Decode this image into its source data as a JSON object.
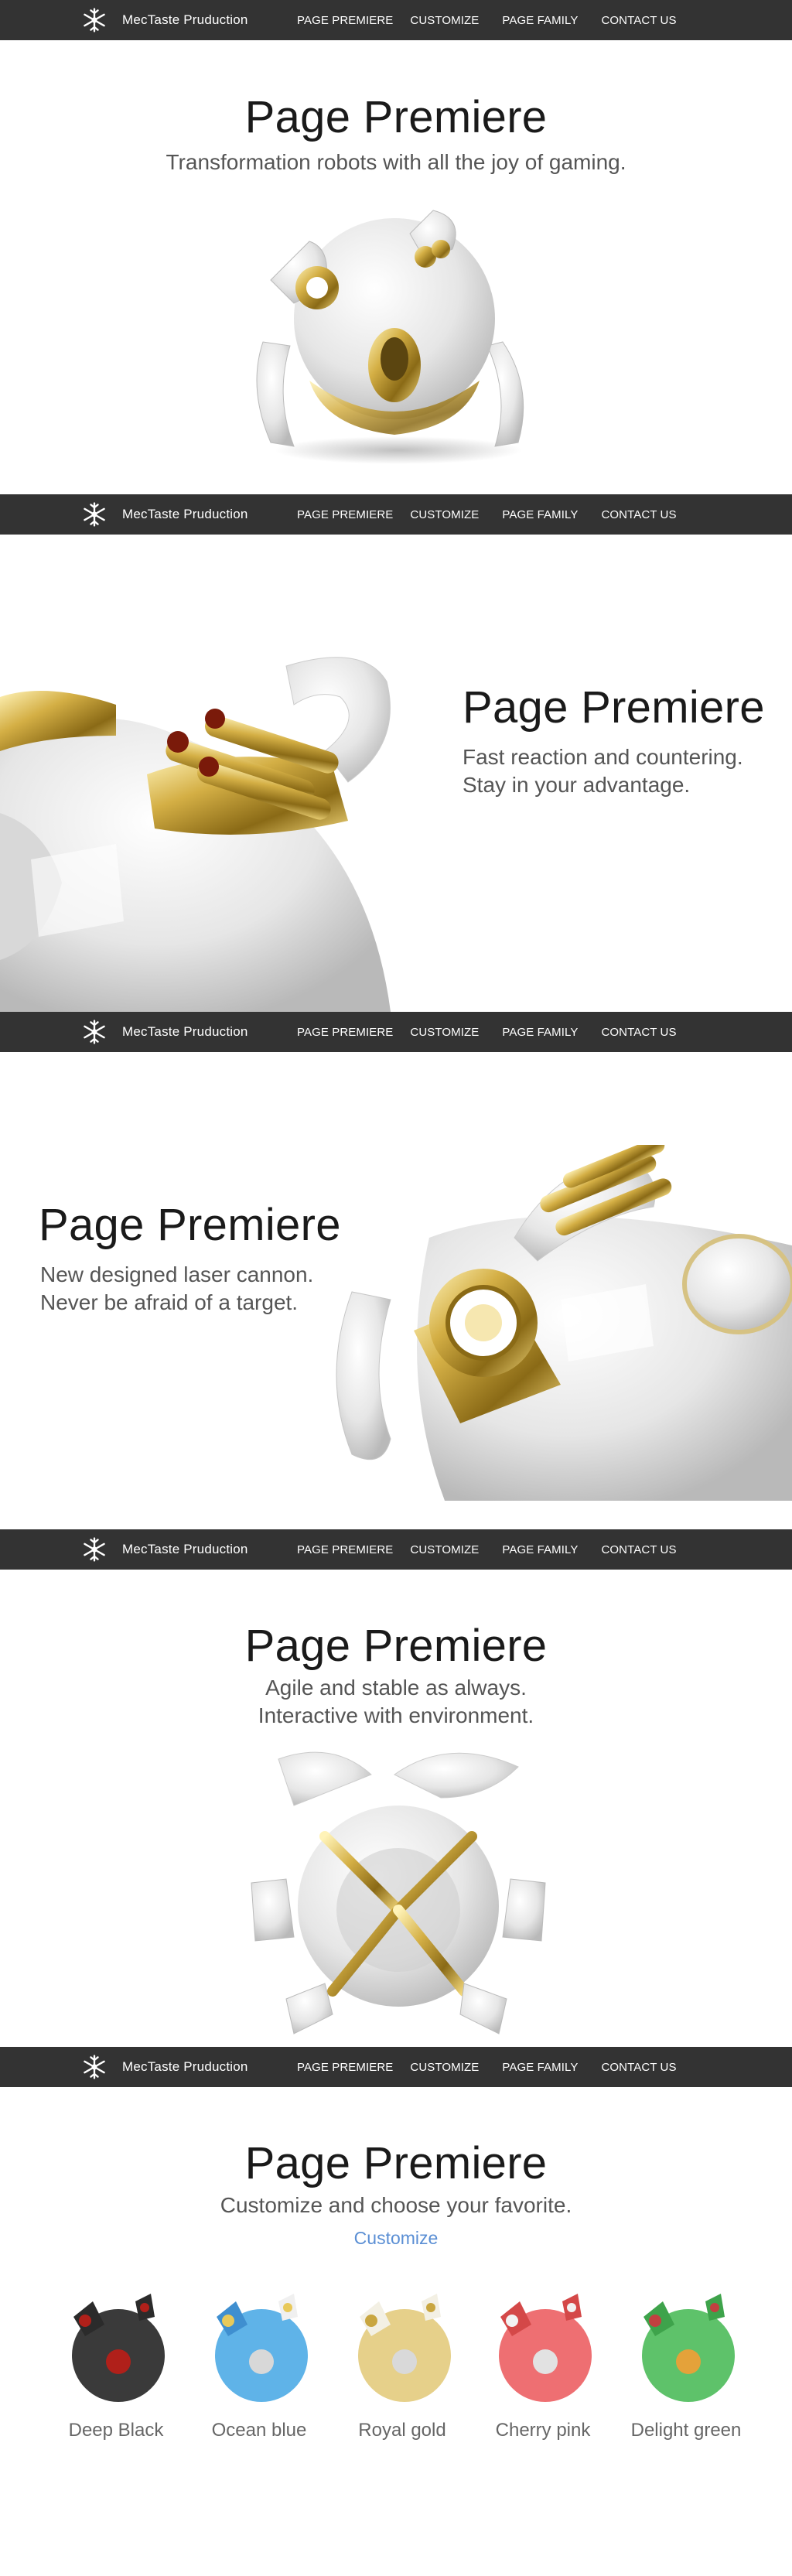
{
  "nav": {
    "brand": "MecTaste Pruduction",
    "links": [
      "PAGE PREMIERE",
      "CUSTOMIZE",
      "PAGE FAMILY",
      "CONTACT US"
    ]
  },
  "sections": [
    {
      "title": "Page Premiere",
      "subtitle": [
        "Transformation robots with all the joy of gaming."
      ]
    },
    {
      "title": "Page Premiere",
      "subtitle": [
        "Fast reaction and countering.",
        "Stay in your advantage."
      ]
    },
    {
      "title": "Page Premiere",
      "subtitle": [
        "New designed laser cannon.",
        "Never be afraid of a target."
      ]
    },
    {
      "title": "Page Premiere",
      "subtitle": [
        "Agile and stable as always.",
        "Interactive with environment."
      ]
    },
    {
      "title": "Page Premiere",
      "subtitle": [
        "Customize and choose your favorite."
      ],
      "link": "Customize"
    }
  ],
  "colors": {
    "navbar": "#333333",
    "gold": "#c9a640",
    "white_shell": "#e9e9e9",
    "link": "#5b8fd4"
  },
  "swatches": [
    {
      "label": "Deep Black",
      "color": "#3a3a3a"
    },
    {
      "label": "Ocean blue",
      "color": "#5fb3e8"
    },
    {
      "label": "Royal gold",
      "color": "#e6d08a"
    },
    {
      "label": "Cherry pink",
      "color": "#ee6f72"
    },
    {
      "label": "Delight green",
      "color": "#5ec26a"
    }
  ]
}
